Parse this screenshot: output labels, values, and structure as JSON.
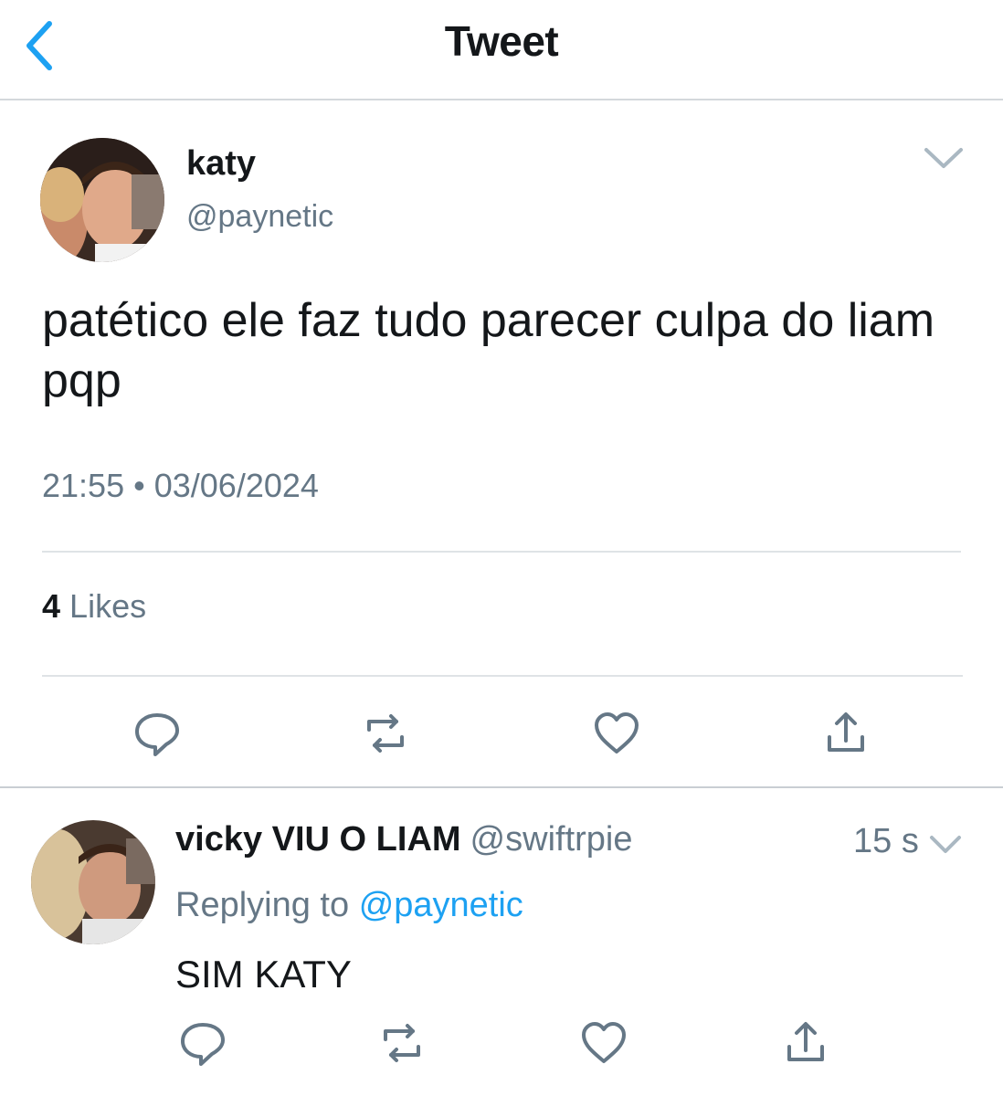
{
  "nav": {
    "title": "Tweet"
  },
  "tweet": {
    "name": "katy",
    "handle": "@paynetic",
    "text": "patético ele faz tudo parecer culpa do liam pqp",
    "time": "21:55",
    "separator": "•",
    "date": "03/06/2024",
    "likes_count": "4",
    "likes_label": "Likes"
  },
  "reply": {
    "name": "vicky VIU O LIAM",
    "handle": "@swiftrpie",
    "time": "15 s",
    "replying_prefix": "Replying to",
    "replying_handle": "@paynetic",
    "text": "SIM KATY"
  },
  "icons": {
    "back": "chevron-left-icon",
    "more": "chevron-down-icon",
    "reply": "speech-bubble-icon",
    "retweet": "retweet-icon",
    "like": "heart-icon",
    "share": "share-icon"
  },
  "colors": {
    "accent": "#1da1f2",
    "secondary_text": "#657786",
    "icon_gray": "#657786"
  }
}
